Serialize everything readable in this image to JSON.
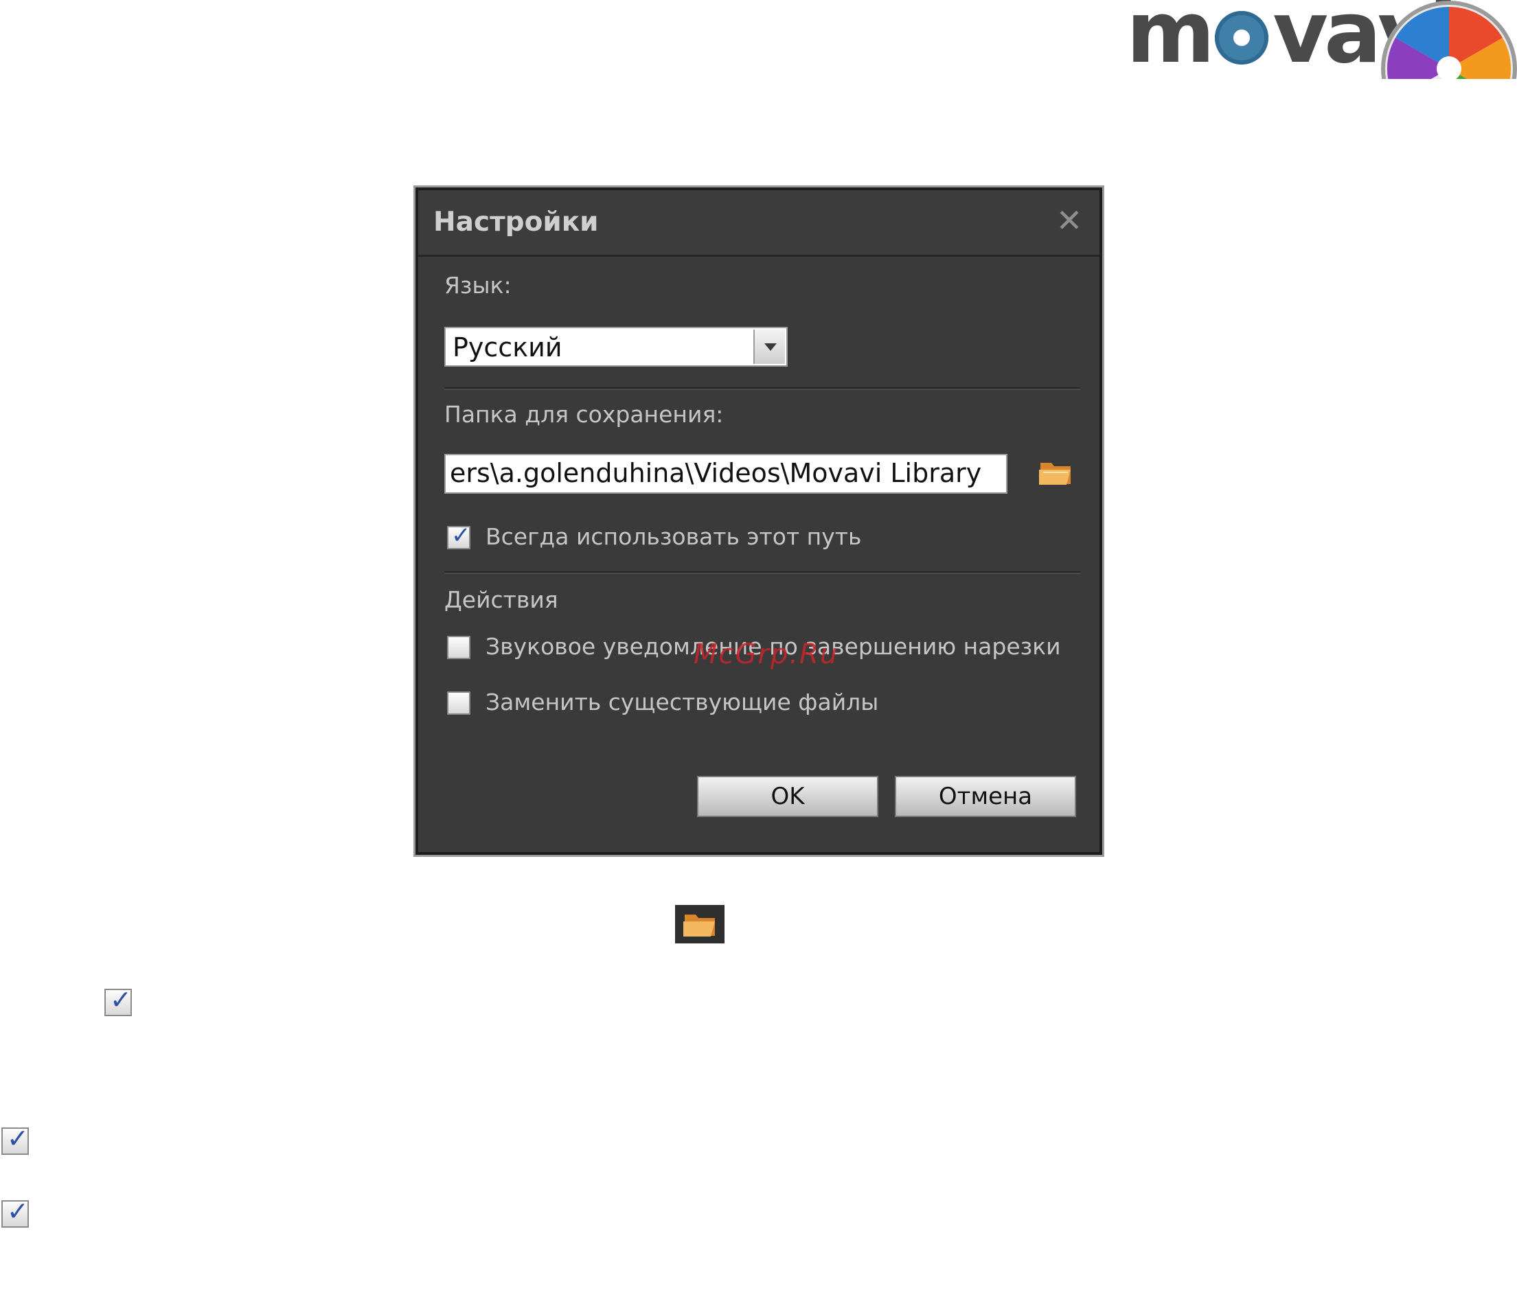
{
  "logo": {
    "wordmark": "movavi",
    "icon": "movavi-pinwheel-icon"
  },
  "dialog": {
    "title": "Настройки",
    "close_icon": "close-icon",
    "language": {
      "label": "Язык:",
      "selected": "Русский"
    },
    "save_folder": {
      "label": "Папка для сохранения:",
      "path": "ers\\a.golenduhina\\Videos\\Movavi Library",
      "browse_icon": "folder-open-icon",
      "always_use": {
        "label": "Всегда использовать этот путь",
        "checked": true
      }
    },
    "actions": {
      "label": "Действия",
      "sound_notification": {
        "label": "Звуковое уведомление по завершению нарезки",
        "checked": false
      },
      "replace_files": {
        "label": "Заменить существующие файлы",
        "checked": false
      }
    },
    "buttons": {
      "ok": "OK",
      "cancel": "Отмена"
    }
  },
  "watermark": "McGrp.Ru",
  "page_icons": {
    "folder": "folder-open-icon",
    "checkboxes": [
      {
        "checked": true
      },
      {
        "checked": true
      },
      {
        "checked": true
      }
    ]
  }
}
